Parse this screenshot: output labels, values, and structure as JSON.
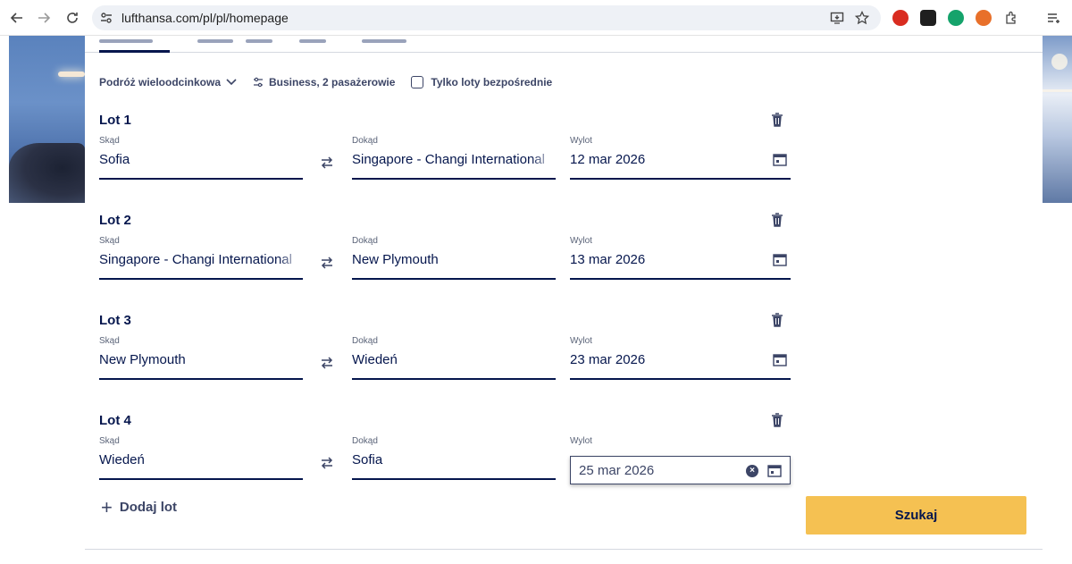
{
  "browser": {
    "url": "lufthansa.com/pl/pl/homepage"
  },
  "options": {
    "trip_type": "Podróż wieloodcinkowa",
    "passengers": "Business, 2 pasażerowie",
    "direct_only": "Tylko loty bezpośrednie"
  },
  "labels": {
    "from": "Skąd",
    "to": "Dokąd",
    "departure": "Wylot"
  },
  "lots": [
    {
      "title": "Lot 1",
      "from": "Sofia",
      "to": "Singapore - Changi International",
      "date": "12 mar 2026"
    },
    {
      "title": "Lot 2",
      "from": "Singapore - Changi International",
      "to": "New Plymouth",
      "date": "13 mar 2026"
    },
    {
      "title": "Lot 3",
      "from": "New Plymouth",
      "to": "Wiedeń",
      "date": "23 mar 2026"
    },
    {
      "title": "Lot 4",
      "from": "Wiedeń",
      "to": "Sofia",
      "date": "25 mar 2026"
    }
  ],
  "actions": {
    "add_lot": "Dodaj lot",
    "search": "Szukaj"
  },
  "colors": {
    "primary": "#05164d",
    "search_button": "#f5c152"
  }
}
